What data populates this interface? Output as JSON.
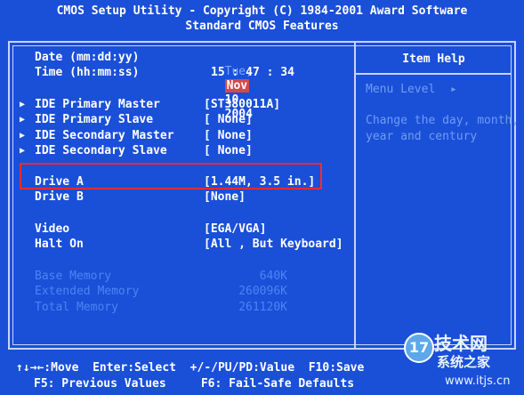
{
  "header": {
    "line1": "CMOS Setup Utility - Copyright (C) 1984-2001 Award Software",
    "line2": "Standard CMOS Features"
  },
  "date": {
    "label": "Date (mm:dd:yy)",
    "day": "Tue,",
    "month": "Nov",
    "daynum": "10",
    "year": "2004"
  },
  "time": {
    "label": "Time (hh:mm:ss)",
    "value": "15 : 47 : 34"
  },
  "ide": [
    {
      "label": "IDE Primary Master",
      "value": "[ST380011A]"
    },
    {
      "label": "IDE Primary Slave",
      "value": "[ None]"
    },
    {
      "label": "IDE Secondary Master",
      "value": "[ None]"
    },
    {
      "label": "IDE Secondary Slave",
      "value": "[ None]"
    }
  ],
  "drive_a": {
    "label": "Drive A",
    "value": "[1.44M, 3.5 in.]"
  },
  "drive_b": {
    "label": "Drive B",
    "value": "[None]"
  },
  "video": {
    "label": "Video",
    "value": "[EGA/VGA]"
  },
  "halt_on": {
    "label": "Halt On",
    "value": "[All , But Keyboard]"
  },
  "memory": [
    {
      "label": "Base Memory",
      "value": "640K"
    },
    {
      "label": "Extended Memory",
      "value": "260096K"
    },
    {
      "label": "Total Memory",
      "value": "261120K"
    }
  ],
  "help": {
    "title": "Item Help",
    "menu_level": "Menu Level",
    "menu_level_arrow": "▸",
    "description_line1": "Change the day, month,",
    "description_line2": "year and century"
  },
  "footer": {
    "line1": "↑↓→←:Move  Enter:Select  +/-/PU/PD:Value  F10:Save",
    "line2": "F5: Previous Values     F6: Fail-Safe Defaults"
  },
  "watermark": {
    "badge": "17",
    "title": "技术网",
    "subtitle": "系统之家",
    "url": "www.itjs.cn"
  },
  "colors": {
    "background": "#1a4fd8",
    "highlight_box": "#ff2a2a",
    "selected_month_bg": "#d24a4a"
  }
}
